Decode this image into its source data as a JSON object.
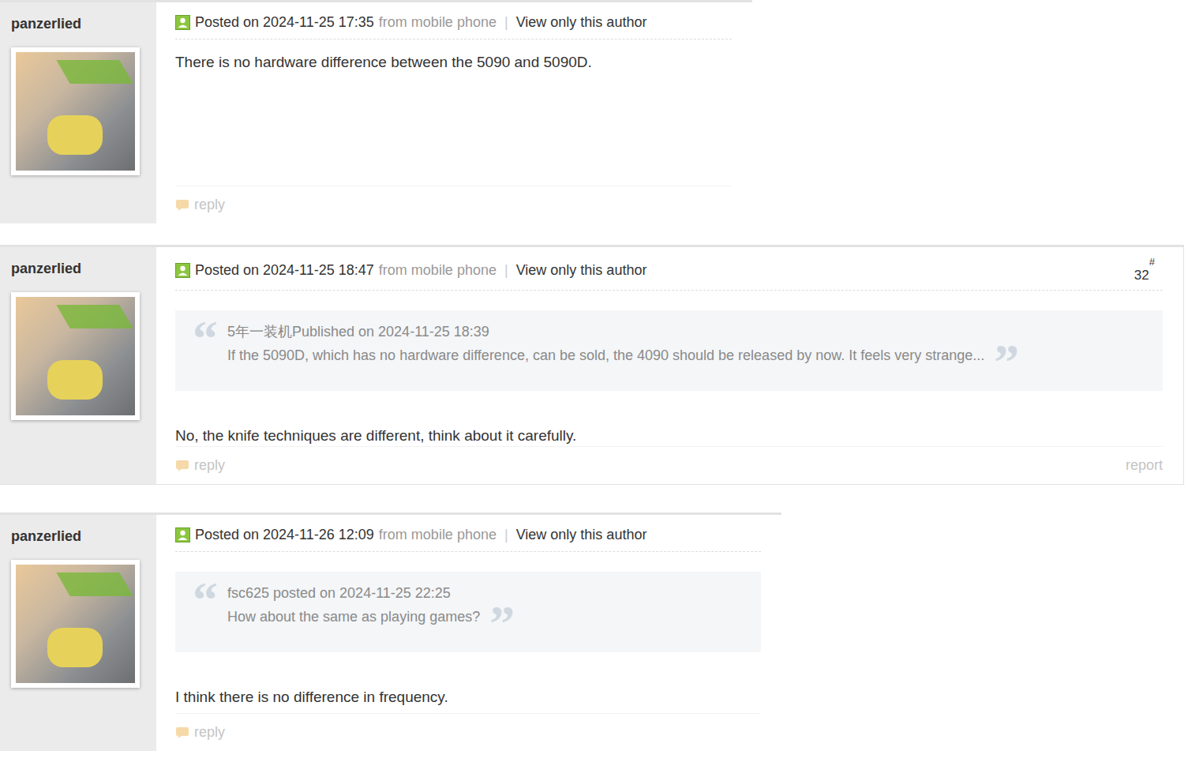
{
  "posts": [
    {
      "author": "panzerlied",
      "posted": "Posted on 2024-11-25 17:35",
      "source": "from mobile phone",
      "separator": "|",
      "view_only": "View only this author",
      "floor": null,
      "quote": null,
      "body": "There is no hardware difference between the 5090 and 5090D.",
      "reply": "reply",
      "report": null
    },
    {
      "author": "panzerlied",
      "posted": "Posted on 2024-11-25 18:47",
      "source": "from mobile phone",
      "separator": "|",
      "view_only": "View only this author",
      "floor": {
        "hash": "#",
        "number": "32"
      },
      "quote": {
        "open_mark": "“",
        "close_mark": "”",
        "header": "5年一装机Published on 2024-11-25 18:39",
        "text": "If the 5090D, which has no hardware difference, can be sold, the 4090 should be released by now. It feels very strange..."
      },
      "body": "No, the knife techniques are different, think about it carefully.",
      "reply": "reply",
      "report": "report"
    },
    {
      "author": "panzerlied",
      "posted": "Posted on 2024-11-26 12:09",
      "source": "from mobile phone",
      "separator": "|",
      "view_only": "View only this author",
      "floor": null,
      "quote": {
        "open_mark": "“",
        "close_mark": "”",
        "header": "fsc625 posted on 2024-11-25 22:25",
        "text": "How about the same as playing games?"
      },
      "body": "I think there is no difference in frequency.",
      "reply": "reply",
      "report": null
    }
  ]
}
